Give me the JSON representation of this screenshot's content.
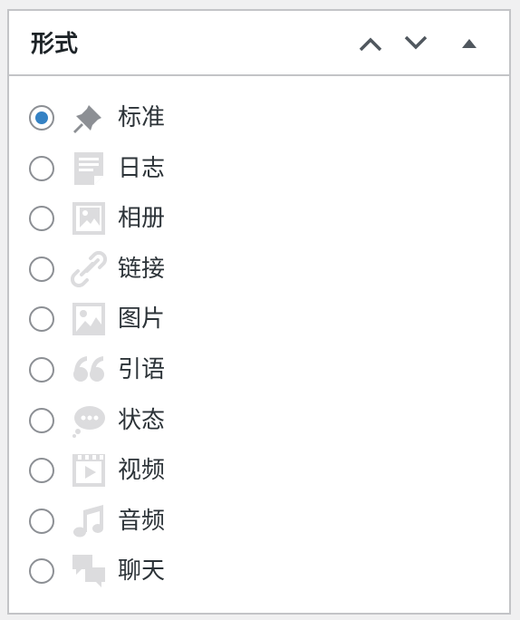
{
  "metabox": {
    "title": "形式",
    "move_up_icon": "chevron-up-icon",
    "move_down_icon": "chevron-down-icon",
    "toggle_icon": "triangle-up-icon"
  },
  "formats": [
    {
      "label": "标准",
      "icon": "thumbtack-icon",
      "checked": true
    },
    {
      "label": "日志",
      "icon": "document-icon",
      "checked": false
    },
    {
      "label": "相册",
      "icon": "gallery-icon",
      "checked": false
    },
    {
      "label": "链接",
      "icon": "link-icon",
      "checked": false
    },
    {
      "label": "图片",
      "icon": "image-icon",
      "checked": false
    },
    {
      "label": "引语",
      "icon": "quote-icon",
      "checked": false
    },
    {
      "label": "状态",
      "icon": "status-bubble-icon",
      "checked": false
    },
    {
      "label": "视频",
      "icon": "video-icon",
      "checked": false
    },
    {
      "label": "音频",
      "icon": "audio-icon",
      "checked": false
    },
    {
      "label": "聊天",
      "icon": "chat-icon",
      "checked": false
    }
  ],
  "colors": {
    "radio_checked": "#3582c4",
    "active_icon": "#8c8f94",
    "inactive_icon": "#dcdcde",
    "border": "#c3c4c7"
  }
}
